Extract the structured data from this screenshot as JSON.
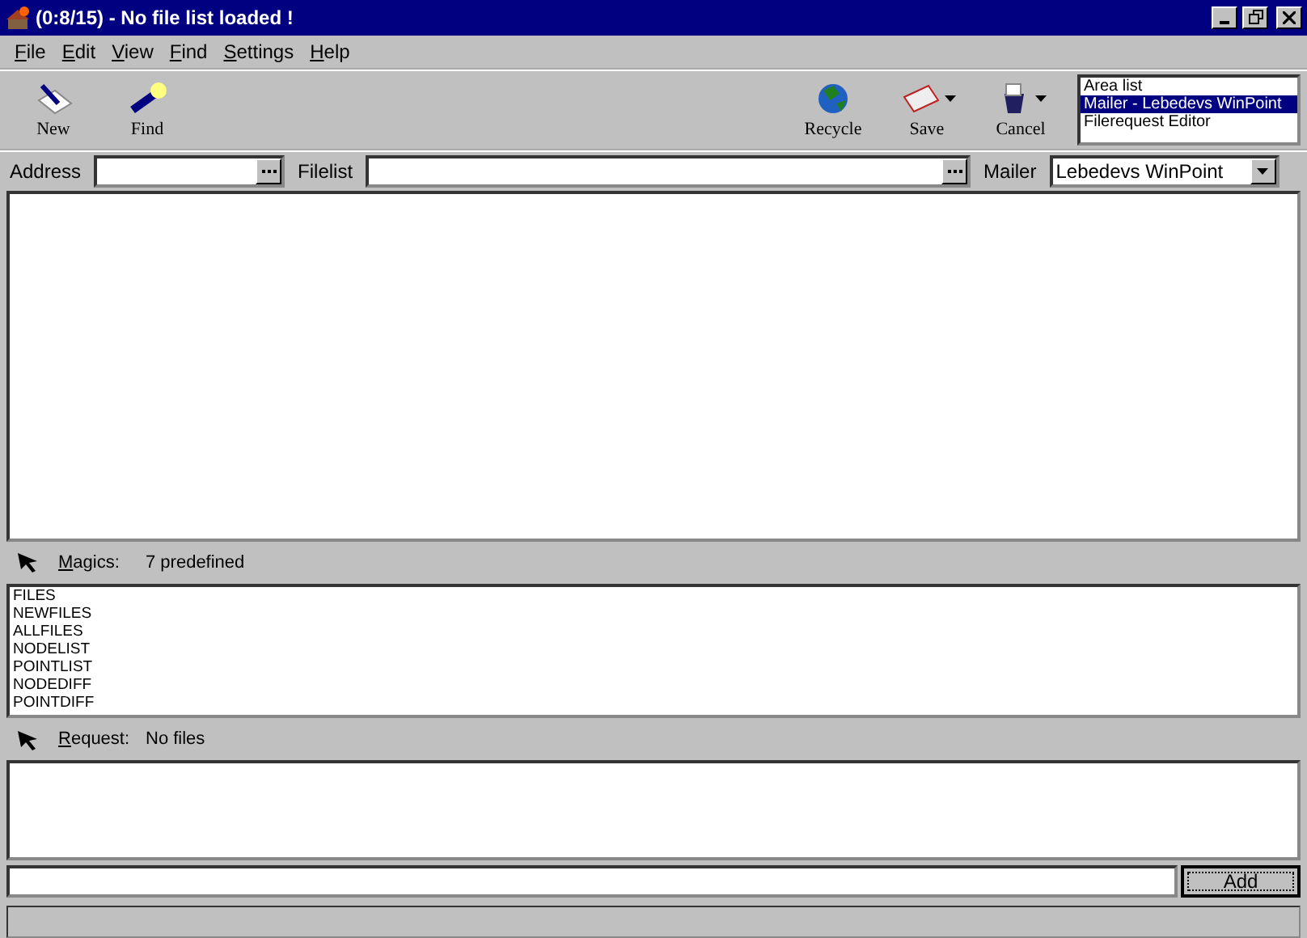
{
  "window": {
    "title": "(0:8/15) - No file list loaded !"
  },
  "menu": [
    "File",
    "Edit",
    "View",
    "Find",
    "Settings",
    "Help"
  ],
  "toolbar_left": [
    {
      "label": "New",
      "kind": "new"
    },
    {
      "label": "Find",
      "kind": "find"
    }
  ],
  "toolbar_right": [
    {
      "label": "Recycle",
      "kind": "recycle",
      "dropdown": false
    },
    {
      "label": "Save",
      "kind": "save",
      "dropdown": true
    },
    {
      "label": "Cancel",
      "kind": "cancel",
      "dropdown": true
    }
  ],
  "view_list": [
    {
      "label": "Area list",
      "selected": false
    },
    {
      "label": "Mailer - Lebedevs WinPoint",
      "selected": true
    },
    {
      "label": "Filerequest Editor",
      "selected": false
    }
  ],
  "address": {
    "label": "Address"
  },
  "filelist": {
    "label": "Filelist"
  },
  "mailer": {
    "label": "Mailer",
    "value": "Lebedevs WinPoint"
  },
  "magics": {
    "label": "Magics:",
    "count": "7 predefined",
    "items": [
      "FILES",
      "NEWFILES",
      "ALLFILES",
      "NODELIST",
      "POINTLIST",
      "NODEDIFF",
      "POINTDIFF"
    ]
  },
  "request": {
    "label": "Request:",
    "count": "No files"
  },
  "add_button": "Add"
}
